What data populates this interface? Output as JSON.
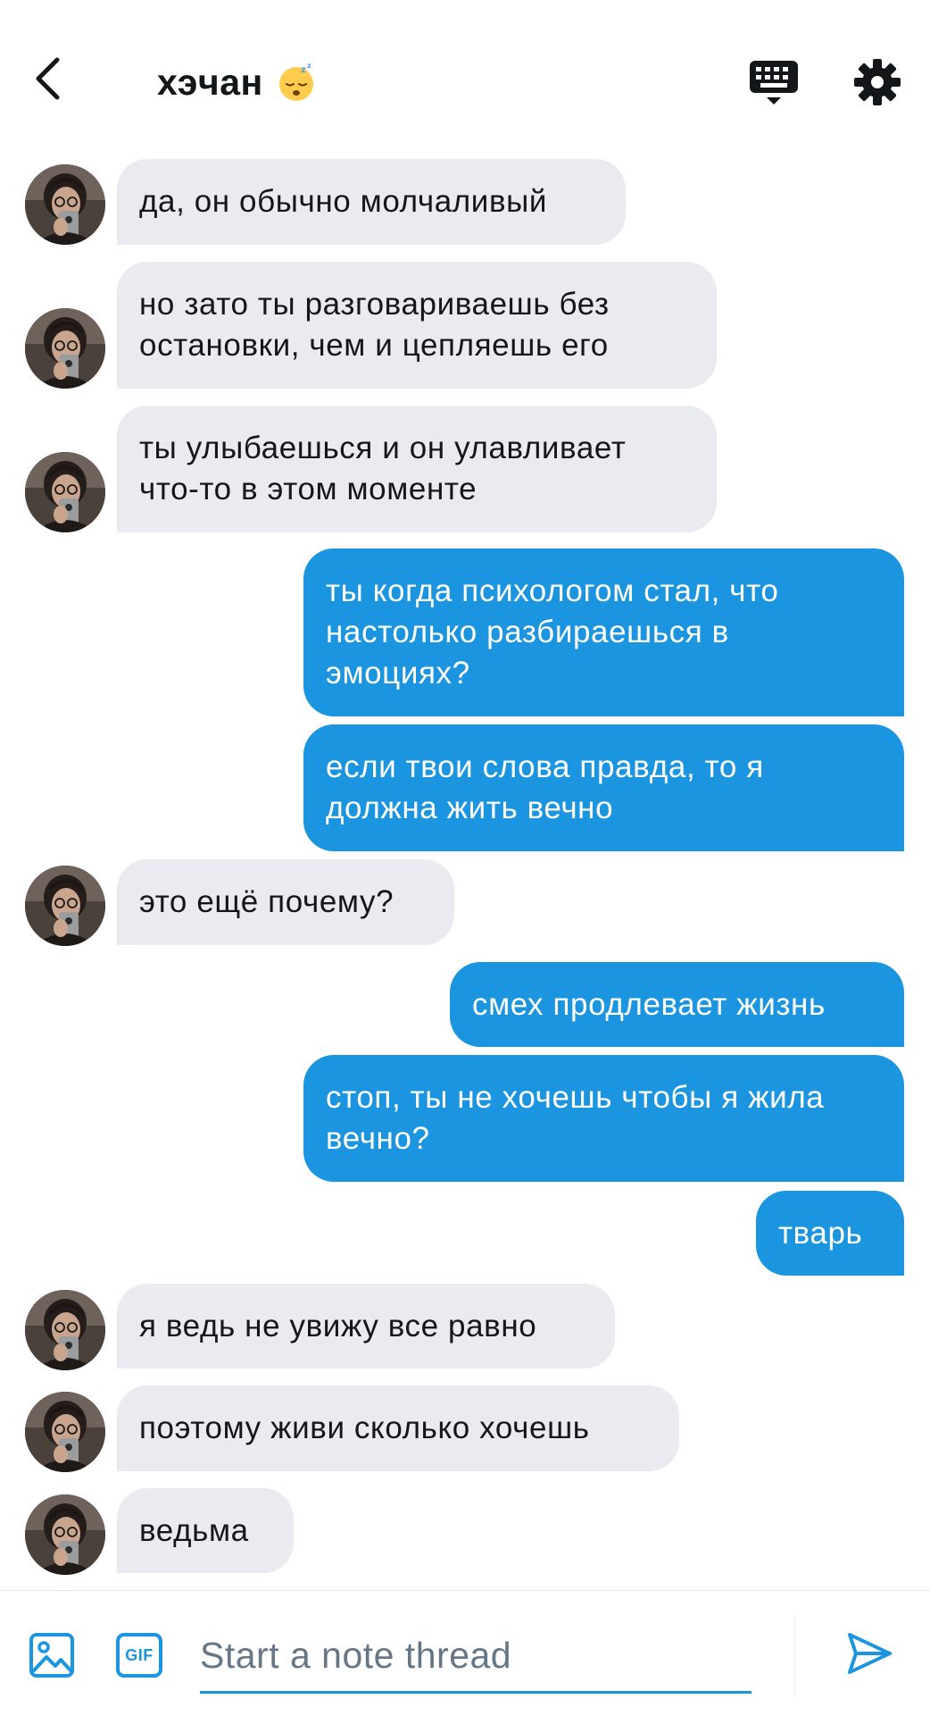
{
  "header": {
    "title": "хэчан",
    "title_emoji": "sleeping-face-emoji",
    "back_icon": "chevron-left-icon",
    "keyboard_icon": "keyboard-icon",
    "settings_icon": "gear-icon"
  },
  "messages": [
    {
      "direction": "in",
      "text": "да, он обычно молчаливый"
    },
    {
      "direction": "in",
      "text": "но зато ты разговариваешь без\nостановки, чем и цепляешь его"
    },
    {
      "direction": "in",
      "text": "ты улыбаешься и он улавливает\nчто-то в этом моменте"
    },
    {
      "direction": "out",
      "text": "ты когда психологом стал, что\nнастолько разбираешься в\nэмоциях?"
    },
    {
      "direction": "out",
      "text": "если твои слова правда, то я\nдолжна жить вечно"
    },
    {
      "direction": "in",
      "text": "это ещё почему?"
    },
    {
      "direction": "out",
      "text": "смех продлевает жизнь"
    },
    {
      "direction": "out",
      "text": "стоп, ты не хочешь чтобы я жила\nвечно?"
    },
    {
      "direction": "out",
      "text": "тварь"
    },
    {
      "direction": "in",
      "text": "я ведь не увижу все равно"
    },
    {
      "direction": "in",
      "text": "поэтому живи сколько хочешь"
    },
    {
      "direction": "in",
      "text": "ведьма"
    }
  ],
  "composer": {
    "placeholder": "Start a note thread",
    "value": "",
    "photo_icon": "image-icon",
    "gif_label": "GIF",
    "send_icon": "send-icon"
  },
  "colors": {
    "accent": "#1b95e0",
    "incoming_bubble": "#e9ebf1",
    "text": "#14171a",
    "placeholder": "#657786"
  }
}
